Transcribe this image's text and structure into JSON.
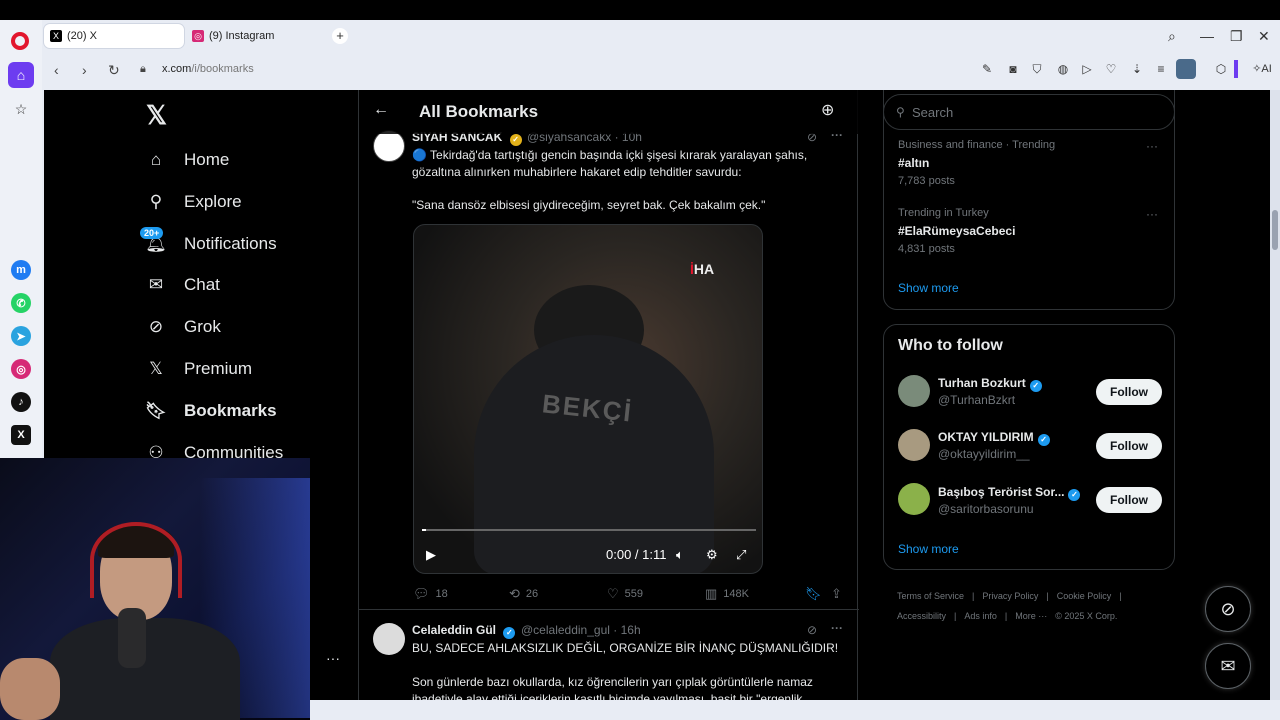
{
  "browser": {
    "tabs": [
      {
        "label": "(20) X",
        "active": true
      },
      {
        "label": "(9) Instagram",
        "active": false
      }
    ],
    "url_host": "x.com",
    "url_path": "/i/bookmarks",
    "ai_label": "AI"
  },
  "nav": {
    "items": [
      {
        "label": "Home",
        "icon": "home-icon"
      },
      {
        "label": "Explore",
        "icon": "search-icon"
      },
      {
        "label": "Notifications",
        "icon": "bell-icon"
      },
      {
        "label": "Chat",
        "icon": "mail-icon"
      },
      {
        "label": "Grok",
        "icon": "grok-icon"
      },
      {
        "label": "Premium",
        "icon": "x-icon"
      },
      {
        "label": "Bookmarks",
        "icon": "bookmark-icon"
      },
      {
        "label": "Communities",
        "icon": "communities-icon"
      }
    ],
    "notifications_badge": "20+"
  },
  "header": {
    "title": "All Bookmarks"
  },
  "posts": [
    {
      "name": "SIYAH SANCAK",
      "handle": "@siyahsancakx",
      "time": "· 10h",
      "text1": "🔵 Tekirdağ'da tartıştığı gencin başında içki şişesi kırarak yaralayan şahıs, gözaltına alınırken muhabirlere hakaret edip tehditler savurdu:",
      "text2": "\"Sana dansöz elbisesi giydireceğim, seyret bak. Çek bakalım çek.\"",
      "video": {
        "watermark_i": "İ",
        "watermark_ha": "HA",
        "jacket_text": "BEKÇİ",
        "time": "0:00 / 1:11",
        "progress": 0.0
      },
      "replies": "18",
      "reposts": "26",
      "likes": "559",
      "views": "148K"
    },
    {
      "name": "Celaleddin Gül",
      "handle": "@celaleddin_gul",
      "time": "· 16h",
      "text1": "BU, SADECE AHLAKSIZLIK DEĞİL, ORGANİZE BİR İNANÇ DÜŞMANLIĞIDIR!",
      "text2": "Son günlerde bazı okullarda, kız öğrencilerin yarı çıplak görüntülerle namaz ibadetiyle alay ettiği içeriklerin kasıtlı biçimde yayılması, basit bir \"ergenlik"
    }
  ],
  "sidebar": {
    "search_placeholder": "Search",
    "trends": [
      {
        "meta": "Business and finance · Trending",
        "name": "#altın",
        "posts": "7,783 posts"
      },
      {
        "meta": "Trending in Turkey",
        "name": "#ElaRümeysaCebeci",
        "posts": "4,831 posts"
      }
    ],
    "show_more": "Show more",
    "who_to_follow_title": "Who to follow",
    "follow_label": "Follow",
    "who_to_follow": [
      {
        "name": "Turhan Bozkurt",
        "handle": "@TurhanBzkrt"
      },
      {
        "name": "OKTAY YILDIRIM",
        "handle": "@oktayyildirim__"
      },
      {
        "name": "Başıboş Terörist Sor...",
        "handle": "@saritorbasorunu"
      }
    ],
    "footer": [
      "Terms of Service",
      "|",
      "Privacy Policy",
      "|",
      "Cookie Policy",
      "|",
      "Accessibility",
      "|",
      "Ads info",
      "|",
      "More ···",
      "© 2025 X Corp."
    ]
  },
  "colors": {
    "accent": "#1d9bf0",
    "opera_red": "#e2162d",
    "opera_purple": "#6d3cf0"
  }
}
